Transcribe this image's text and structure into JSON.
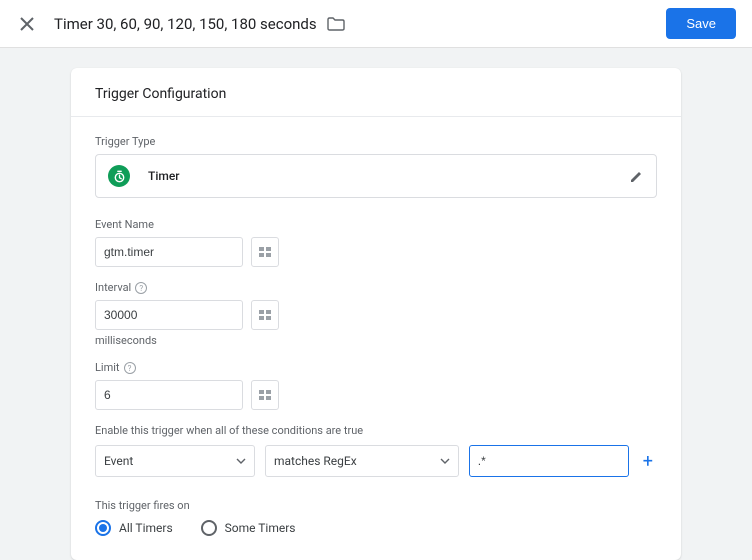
{
  "header": {
    "title": "Timer 30, 60, 90, 120, 150, 180  seconds",
    "save_label": "Save"
  },
  "card": {
    "title": "Trigger Configuration",
    "trigger_type_label": "Trigger Type",
    "trigger_type_name": "Timer",
    "event_name_label": "Event Name",
    "event_name_value": "gtm.timer",
    "interval_label": "Interval",
    "interval_value": "30000",
    "interval_unit": "milliseconds",
    "limit_label": "Limit",
    "limit_value": "6",
    "conditions_label": "Enable this trigger when all of these conditions are true",
    "condition": {
      "variable": "Event",
      "operator": "matches RegEx",
      "value": ".*"
    },
    "fires_label": "This trigger fires on",
    "fires_options": {
      "all": "All Timers",
      "some": "Some Timers"
    },
    "fires_selected": "all"
  }
}
